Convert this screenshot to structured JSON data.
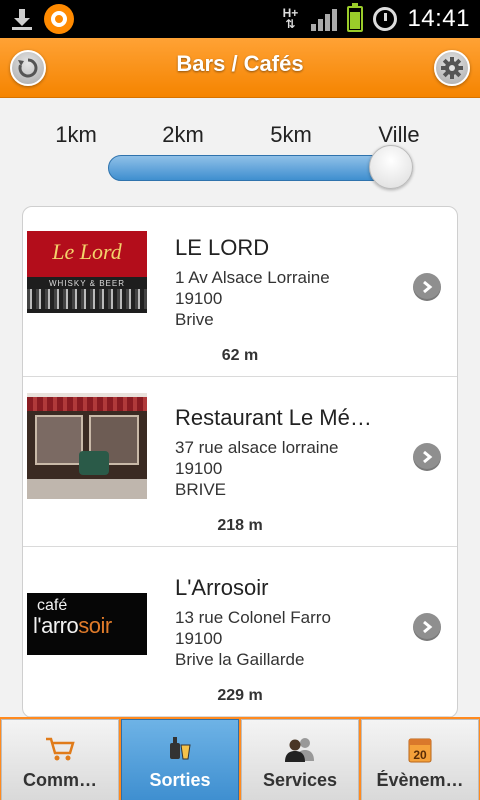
{
  "status_bar": {
    "network": "H+",
    "time": "14:41"
  },
  "header": {
    "title": "Bars / Cafés"
  },
  "distance_slider": {
    "labels": [
      "1km",
      "2km",
      "5km",
      "Ville"
    ],
    "selected": "Ville"
  },
  "list": {
    "items": [
      {
        "name": "LE LORD",
        "address_line1": "1 Av Alsace Lorraine",
        "postal_code": "19100",
        "city": "Brive",
        "distance": "62 m",
        "thumb_text_1": "Le Lord",
        "thumb_text_2": "WHISKY & BEER"
      },
      {
        "name": "Restaurant Le Mé…",
        "address_line1": "37 rue alsace lorraine",
        "postal_code": "19100",
        "city": "BRIVE",
        "distance": "218 m"
      },
      {
        "name": "L'Arrosoir",
        "address_line1": "13 rue Colonel Farro",
        "postal_code": "19100",
        "city": "Brive la Gaillarde",
        "distance": "229 m",
        "thumb_text_1": "café",
        "thumb_text_2a": "l'arro",
        "thumb_text_2b": "soir"
      }
    ]
  },
  "tabs": [
    {
      "label": "Comm…",
      "icon": "cart-icon",
      "active": false
    },
    {
      "label": "Sorties",
      "icon": "drink-icon",
      "active": true
    },
    {
      "label": "Services",
      "icon": "people-icon",
      "active": false
    },
    {
      "label": "Évènem…",
      "icon": "calendar-icon",
      "active": false,
      "calendar_day": "20"
    }
  ],
  "colors": {
    "header_orange": "#f58400",
    "slider_blue": "#3f8fcf",
    "active_tab_blue": "#3f8fd0"
  }
}
